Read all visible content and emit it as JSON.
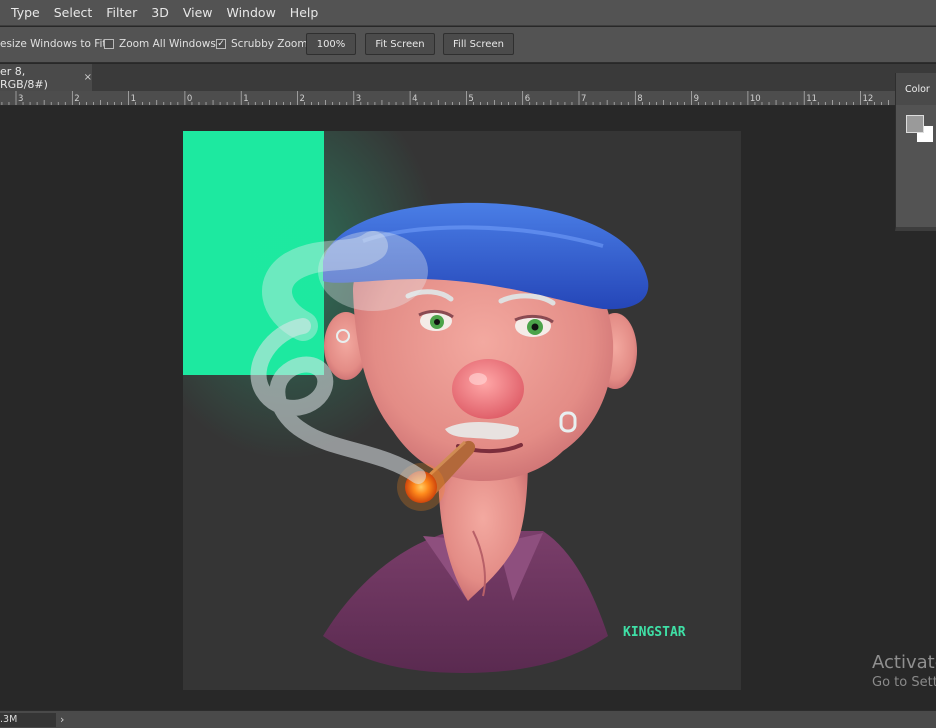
{
  "menubar": {
    "items": [
      "Type",
      "Select",
      "Filter",
      "3D",
      "View",
      "Window",
      "Help"
    ]
  },
  "options": {
    "resize_windows": "esize Windows to Fit",
    "zoom_all": "Zoom All Windows",
    "scrubby_zoom": "Scrubby Zoom",
    "scrubby_checked": true,
    "zoom_all_checked": false,
    "zoom_value": "100%",
    "fit_screen": "Fit Screen",
    "fill_screen": "Fill Screen"
  },
  "tab": {
    "title": "er 8, RGB/8#)",
    "close": "×"
  },
  "ruler": {
    "labels": [
      "3",
      "2",
      "1",
      "0",
      "1",
      "2",
      "3",
      "4",
      "5",
      "6",
      "7",
      "8",
      "9",
      "10",
      "11",
      "12"
    ]
  },
  "color_panel": {
    "title": "Color",
    "foreground": "#9a9a9a",
    "background": "#ffffff"
  },
  "artwork": {
    "signature": "KINGSTAR",
    "accent": "#1de9a0"
  },
  "watermark": {
    "line1": "Activate",
    "line2": "Go to Sett"
  },
  "status": {
    "doc_size": ".3M",
    "arrow": "›"
  }
}
